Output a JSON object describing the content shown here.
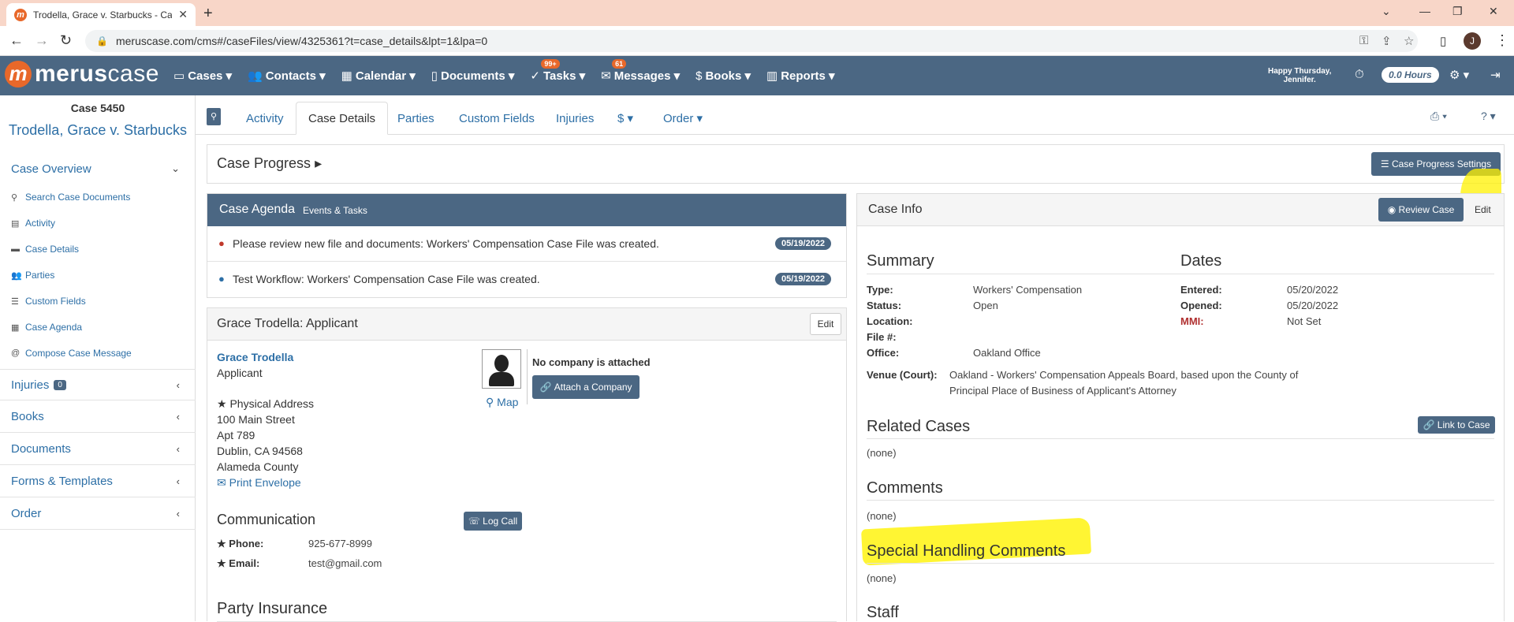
{
  "browser": {
    "tab_title": "Trodella, Grace v. Starbucks - Cas",
    "url": "meruscase.com/cms#/caseFiles/view/4325361?t=case_details&lpt=1&lpa=0",
    "avatar_letter": "J"
  },
  "header": {
    "logo_bold": "merus",
    "logo_light": "case",
    "menu": [
      {
        "label": "Cases",
        "icon": "▭"
      },
      {
        "label": "Contacts",
        "icon": "👥"
      },
      {
        "label": "Calendar",
        "icon": "▦"
      },
      {
        "label": "Documents",
        "icon": "▯"
      },
      {
        "label": "Tasks",
        "icon": "✓",
        "badge": "99+"
      },
      {
        "label": "Messages",
        "icon": "✉",
        "badge": "61"
      },
      {
        "label": "Books",
        "icon": "$"
      },
      {
        "label": "Reports",
        "icon": "▥"
      }
    ],
    "greeting_line1": "Happy Thursday,",
    "greeting_line2": "Jennifer.",
    "hours": "0.0 Hours"
  },
  "sidebar": {
    "case_number": "Case 5450",
    "case_title": "Trodella, Grace v. Starbucks",
    "overview_label": "Case Overview",
    "items": [
      {
        "label": "Search Case Documents",
        "icon": "⚲"
      },
      {
        "label": "Activity",
        "icon": "▤"
      },
      {
        "label": "Case Details",
        "icon": "▬"
      },
      {
        "label": "Parties",
        "icon": "👥"
      },
      {
        "label": "Custom Fields",
        "icon": "☰"
      },
      {
        "label": "Case Agenda",
        "icon": "▦"
      },
      {
        "label": "Compose Case Message",
        "icon": "@"
      }
    ],
    "sections": [
      {
        "label": "Injuries",
        "count": "0"
      },
      {
        "label": "Books"
      },
      {
        "label": "Documents"
      },
      {
        "label": "Forms & Templates"
      },
      {
        "label": "Order"
      }
    ]
  },
  "tabs": [
    {
      "label": "Activity"
    },
    {
      "label": "Case Details"
    },
    {
      "label": "Parties"
    },
    {
      "label": "Custom Fields"
    },
    {
      "label": "Injuries"
    },
    {
      "label": "$ ▾"
    },
    {
      "label": "Order ▾"
    }
  ],
  "progress": {
    "title": "Case Progress",
    "settings_button": "Case Progress Settings"
  },
  "agenda": {
    "title": "Case Agenda",
    "subtitle": "Events & Tasks",
    "items": [
      {
        "text": "Please review new file and documents: Workers' Compensation Case File was created.",
        "date": "05/19/2022",
        "color": "#c0392b"
      },
      {
        "text": "Test Workflow: Workers' Compensation Case File was created.",
        "date": "05/19/2022",
        "color": "#2d6fa6"
      }
    ]
  },
  "applicant": {
    "panel_title": "Grace Trodella: Applicant",
    "edit": "Edit",
    "name": "Grace Trodella",
    "role": "Applicant",
    "address_label": "Physical Address",
    "address": [
      "100 Main Street",
      "Apt 789",
      "Dublin, CA 94568",
      "Alameda County"
    ],
    "print_envelope": "Print Envelope",
    "map": "Map",
    "no_company": "No company is attached",
    "attach_company": "Attach a Company",
    "communication_title": "Communication",
    "log_call": "Log Call",
    "phone_label": "Phone:",
    "phone": "925-677-8999",
    "email_label": "Email:",
    "email": "test@gmail.com",
    "insurance_title": "Party Insurance"
  },
  "case_info": {
    "title": "Case Info",
    "review_button": "Review Case",
    "edit": "Edit",
    "summary_title": "Summary",
    "dates_title": "Dates",
    "type_label": "Type:",
    "type": "Workers' Compensation",
    "status_label": "Status:",
    "status": "Open",
    "location_label": "Location:",
    "file_label": "File #:",
    "office_label": "Office:",
    "office": "Oakland Office",
    "venue_label": "Venue (Court):",
    "venue_line1": "Oakland - Workers' Compensation Appeals Board, based upon the County of",
    "venue_line2": "Principal Place of Business of Applicant's Attorney",
    "entered_label": "Entered:",
    "entered": "05/20/2022",
    "opened_label": "Opened:",
    "opened": "05/20/2022",
    "mmi_label": "MMI:",
    "mmi": "Not Set",
    "related_title": "Related Cases",
    "link_button": "Link to Case",
    "related_value": "(none)",
    "comments_title": "Comments",
    "comments_value": "(none)",
    "special_title": "Special Handling Comments",
    "special_value": "(none)",
    "staff_title": "Staff"
  },
  "colors": {
    "header_bg": "#4b6783",
    "brand_orange": "#e8682a",
    "link_blue": "#2d6fa6",
    "highlight": "#fff200"
  }
}
